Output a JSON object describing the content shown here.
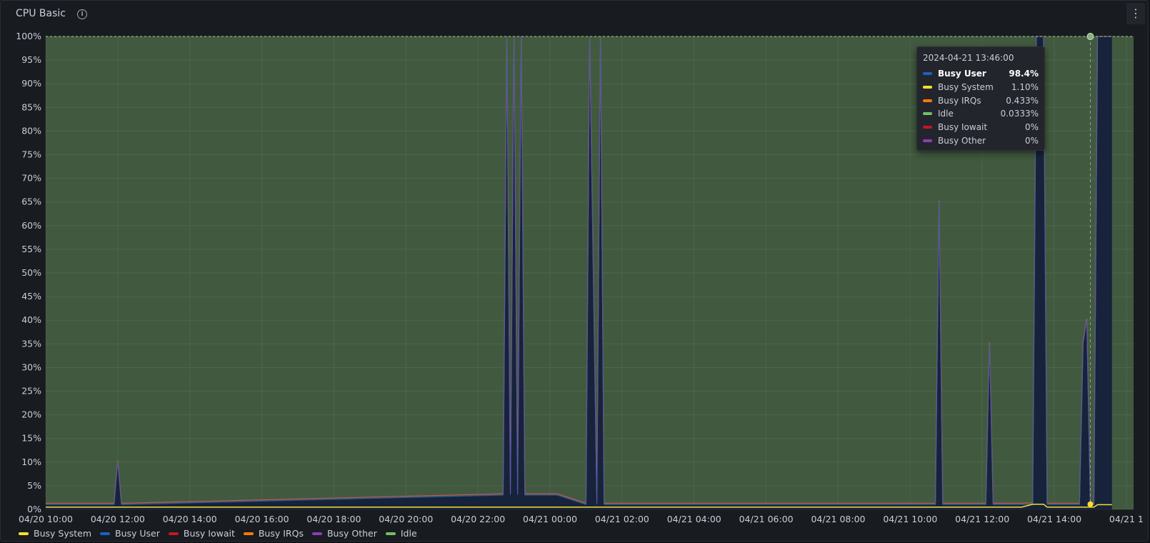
{
  "panel": {
    "title": "CPU Basic",
    "info_icon": "info-icon",
    "menu_icon": "more-vertical-icon",
    "menu_label": "⋮"
  },
  "colors": {
    "busy_system": "#fade2a",
    "busy_user": "#1f60c4",
    "busy_iowait": "#c4162a",
    "busy_irqs": "#ff780a",
    "busy_other": "#8f3bb8",
    "idle": "#73bf69"
  },
  "chart_data": {
    "type": "area",
    "stacked": true,
    "y_unit": "%",
    "ylim": [
      0,
      100
    ],
    "y_ticks": [
      "0%",
      "5%",
      "10%",
      "15%",
      "20%",
      "25%",
      "30%",
      "35%",
      "40%",
      "45%",
      "50%",
      "55%",
      "60%",
      "65%",
      "70%",
      "75%",
      "80%",
      "85%",
      "90%",
      "95%",
      "100%"
    ],
    "x_ticks": [
      "04/20 10:00",
      "04/20 12:00",
      "04/20 14:00",
      "04/20 16:00",
      "04/20 18:00",
      "04/20 20:00",
      "04/20 22:00",
      "04/21 00:00",
      "04/21 02:00",
      "04/21 04:00",
      "04/21 06:00",
      "04/21 08:00",
      "04/21 10:00",
      "04/21 12:00",
      "04/21 14:00",
      "04/21 1"
    ],
    "grid": true,
    "legend_position": "bottom-left",
    "x_hours": [
      0,
      0.1,
      0.2,
      1.9,
      2,
      2.1,
      2.2,
      12.7,
      12.8,
      12.9,
      13.0,
      13.1,
      13.2,
      13.3,
      13.4,
      13.5,
      13.6,
      13.7,
      13.8,
      13.9,
      14.0,
      14.1,
      14.2,
      15.0,
      15.1,
      15.3,
      15.4,
      15.5,
      15.6,
      15.7,
      15.8,
      15.9,
      16.0,
      16.1,
      16.2,
      16.3,
      24.6,
      24.7,
      24.8,
      24.9,
      25.0,
      25.1,
      26.0,
      26.1,
      26.2,
      26.3,
      27.0,
      27.1,
      27.4,
      27.5,
      27.6,
      27.7,
      27.8,
      28.6,
      28.7,
      28.8,
      28.9,
      29.0,
      29.1,
      29.2,
      29.3,
      29.4,
      29.5,
      29.6
    ],
    "series": [
      {
        "name": "Busy User",
        "values": [
          1,
          1,
          1,
          1,
          10,
          1,
          1,
          3,
          100,
          3,
          100,
          3,
          100,
          3,
          3,
          3,
          3,
          3,
          3,
          3,
          3,
          3,
          3,
          1,
          100,
          1,
          100,
          1,
          1,
          1,
          1,
          1,
          1,
          1,
          1,
          1,
          1,
          1,
          65,
          1,
          1,
          1,
          1,
          1,
          35,
          1,
          1,
          1,
          1,
          100,
          100,
          100,
          1,
          1,
          1,
          35,
          40,
          1,
          1,
          100,
          100,
          100,
          100,
          100
        ]
      },
      {
        "name": "Busy System",
        "values": [
          0.5,
          0.5,
          0.5,
          0.5,
          0.5,
          0.5,
          0.5,
          0.5,
          0.5,
          0.5,
          0.5,
          0.5,
          0.5,
          0.5,
          0.5,
          0.5,
          0.5,
          0.5,
          0.5,
          0.5,
          0.5,
          0.5,
          0.5,
          0.5,
          0.5,
          0.5,
          0.5,
          0.5,
          0.5,
          0.5,
          0.5,
          0.5,
          0.5,
          0.5,
          0.5,
          0.5,
          0.5,
          0.5,
          0.5,
          0.5,
          0.5,
          0.5,
          0.5,
          0.5,
          0.5,
          0.5,
          0.5,
          0.5,
          1.1,
          1.1,
          1.1,
          1.1,
          0.5,
          0.5,
          0.5,
          0.5,
          0.5,
          0.5,
          0.5,
          1,
          1,
          1,
          1,
          1
        ]
      },
      {
        "name": "Busy IRQs",
        "values": [
          0.3,
          0.3,
          0.3,
          0.3,
          0.3,
          0.3,
          0.3,
          0.3,
          0.3,
          0.3,
          0.3,
          0.3,
          0.3,
          0.3,
          0.3,
          0.3,
          0.3,
          0.3,
          0.3,
          0.3,
          0.3,
          0.3,
          0.3,
          0.3,
          0.3,
          0.3,
          0.3,
          0.3,
          0.3,
          0.3,
          0.3,
          0.3,
          0.3,
          0.3,
          0.3,
          0.3,
          0.3,
          0.3,
          0.3,
          0.3,
          0.3,
          0.3,
          0.3,
          0.3,
          0.3,
          0.3,
          0.3,
          0.3,
          0.4,
          0.4,
          0.4,
          0.4,
          0.3,
          0.3,
          0.3,
          0.3,
          0.3,
          0.3,
          0.3,
          0.4,
          0.4,
          0.4,
          0.4,
          0.4
        ]
      },
      {
        "name": "Busy Iowait",
        "values": [
          0,
          0,
          0,
          0,
          0,
          0,
          0,
          0,
          0,
          0,
          0,
          0,
          0,
          0,
          0,
          0,
          0,
          0,
          0,
          0,
          0,
          0,
          0,
          0,
          0,
          0,
          0,
          0,
          0,
          0,
          0,
          0,
          0,
          0,
          0,
          0,
          0,
          0,
          0,
          0,
          0,
          0,
          0,
          0,
          0,
          0,
          0,
          0,
          0,
          0,
          0,
          0,
          0,
          0,
          0,
          0,
          0,
          0,
          0,
          0,
          0,
          0,
          0,
          0
        ]
      },
      {
        "name": "Busy Other",
        "values": [
          0,
          0,
          0,
          0,
          0,
          0,
          0,
          0,
          0,
          0,
          0,
          0,
          0,
          0,
          0,
          0,
          0,
          0,
          0,
          0,
          0,
          0,
          0,
          0,
          0,
          0,
          0,
          0,
          0,
          0,
          0,
          0,
          0,
          0,
          0,
          0,
          0,
          0,
          0,
          0,
          0,
          0,
          0,
          0,
          0,
          0,
          0,
          0,
          0,
          0,
          0,
          0,
          0,
          0,
          0,
          0,
          0,
          0,
          0,
          0,
          0,
          0,
          0,
          0
        ]
      },
      {
        "name": "Idle",
        "values": [
          98,
          98,
          98,
          98,
          89,
          98,
          98,
          96,
          0,
          96,
          0,
          96,
          0,
          96,
          96,
          96,
          96,
          96,
          96,
          96,
          96,
          96,
          96,
          98,
          0,
          98,
          0,
          98,
          98,
          98,
          98,
          98,
          98,
          98,
          98,
          98,
          98,
          98,
          34,
          98,
          98,
          98,
          98,
          98,
          64,
          98,
          98,
          98,
          98,
          0,
          0,
          0,
          98,
          98,
          98,
          64,
          59,
          98,
          98,
          0,
          0,
          0,
          0,
          0
        ]
      }
    ]
  },
  "legend": [
    {
      "label": "Busy System",
      "color": "#fade2a"
    },
    {
      "label": "Busy User",
      "color": "#1f60c4"
    },
    {
      "label": "Busy Iowait",
      "color": "#c4162a"
    },
    {
      "label": "Busy IRQs",
      "color": "#ff780a"
    },
    {
      "label": "Busy Other",
      "color": "#8f3bb8"
    },
    {
      "label": "Idle",
      "color": "#73bf69"
    }
  ],
  "tooltip": {
    "time": "2024-04-21 13:46:00",
    "rows": [
      {
        "name": "Busy User",
        "value": "98.4%",
        "color": "#1f60c4",
        "bold": true
      },
      {
        "name": "Busy System",
        "value": "1.10%",
        "color": "#fade2a",
        "bold": false
      },
      {
        "name": "Busy IRQs",
        "value": "0.433%",
        "color": "#ff780a",
        "bold": false
      },
      {
        "name": "Idle",
        "value": "0.0333%",
        "color": "#73bf69",
        "bold": false
      },
      {
        "name": "Busy Iowait",
        "value": "0%",
        "color": "#c4162a",
        "bold": false
      },
      {
        "name": "Busy Other",
        "value": "0%",
        "color": "#8f3bb8",
        "bold": false
      }
    ]
  }
}
